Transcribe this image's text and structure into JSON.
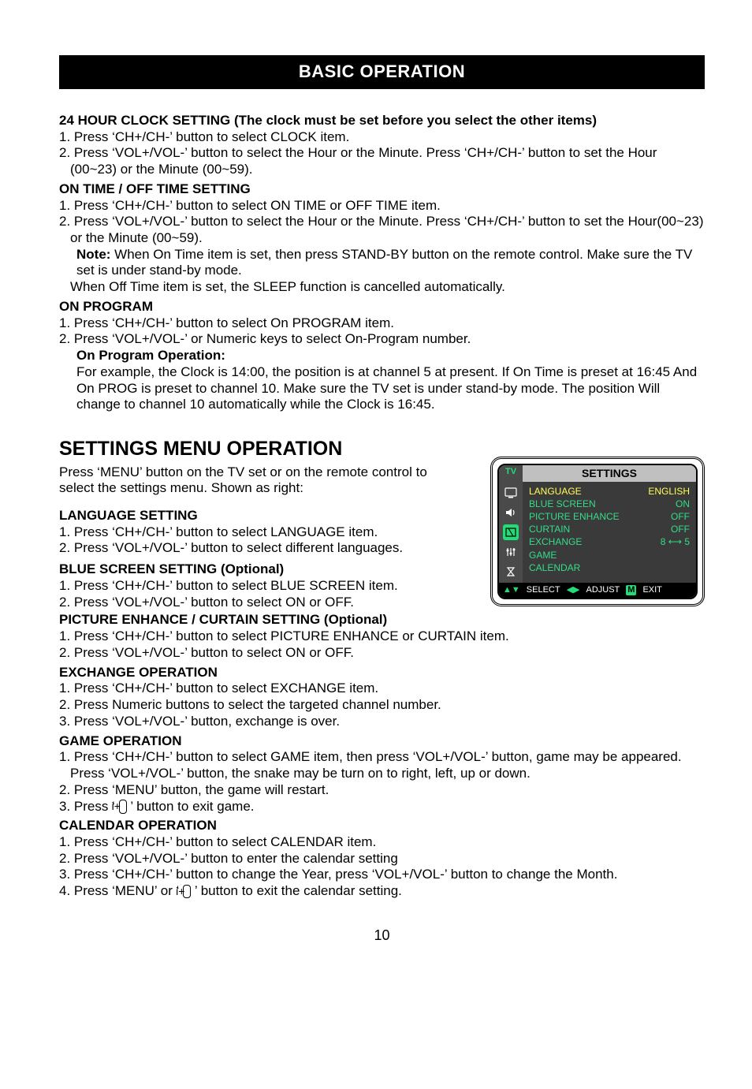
{
  "title_bar": "BASIC OPERATION",
  "clock": {
    "heading": "24 HOUR CLOCK SETTING (The clock must be set before you select the other items)",
    "p1": "1. Press ‘CH+/CH-’ button to select CLOCK item.",
    "p2": "2. Press ‘VOL+/VOL-’ button to select the Hour or the Minute. Press ‘CH+/CH-’ button to set the Hour (00~23) or the Minute (00~59)."
  },
  "ontime": {
    "heading": "ON TIME / OFF TIME SETTING",
    "p1": "1. Press ‘CH+/CH-’ button to select ON TIME or OFF TIME item.",
    "p2": "2. Press ‘VOL+/VOL-’ button to select the Hour or the Minute. Press ‘CH+/CH-’ button to set the Hour(00~23) or the Minute (00~59).",
    "note_label": "Note:",
    "note_body": " When On Time item is set, then press STAND-BY button on the remote control. Make sure the TV set is under stand-by mode.",
    "note2": "When Off Time item is set, the SLEEP function is cancelled automatically."
  },
  "onprog": {
    "heading": "ON PROGRAM",
    "p1": "1. Press ‘CH+/CH-’ button to select On PROGRAM item.",
    "p2": "2. Press ‘VOL+/VOL-’ or Numeric keys to select On-Program number.",
    "sub_heading": "On Program Operation:",
    "body": "For example, the Clock is 14:00, the position is at channel 5 at present. If On Time is preset at 16:45 And On PROG is preset to channel 10. Make sure the TV set is under stand-by mode. The position Will change to channel 10 automatically while the Clock is 16:45."
  },
  "settings": {
    "heading": "SETTINGS MENU OPERATION",
    "intro": "Press ‘MENU’ button on the TV set or on the remote control to select the settings menu. Shown as right:"
  },
  "lang": {
    "heading": "LANGUAGE SETTING",
    "p1": "1. Press ‘CH+/CH-’ button to select LANGUAGE item.",
    "p2": "2. Press ‘VOL+/VOL-’ button to select different languages."
  },
  "blue": {
    "heading": "BLUE SCREEN SETTING (Optional)",
    "p1": "1. Press ‘CH+/CH-’ button to select BLUE SCREEN item.",
    "p2": "2. Press ‘VOL+/VOL-’ button to select ON or OFF."
  },
  "pic": {
    "heading": "PICTURE ENHANCE / CURTAIN SETTING (Optional)",
    "p1": "1. Press ‘CH+/CH-’ button to select PICTURE ENHANCE or CURTAIN item.",
    "p2": "2. Press ‘VOL+/VOL-’ button to select ON or OFF."
  },
  "exch": {
    "heading": "EXCHANGE OPERATION",
    "p1": "1. Press ‘CH+/CH-’ button to select EXCHANGE item.",
    "p2": "2. Press Numeric buttons to select the targeted channel number.",
    "p3": "3. Press ‘VOL+/VOL-’ button, exchange is over."
  },
  "game": {
    "heading": "GAME OPERATION",
    "p1": "1. Press ‘CH+/CH-’ button to select GAME item, then press ‘VOL+/VOL-’ button, game may be appeared. Press ‘VOL+/VOL-’ button, the snake may be turn on to right, left, up or down.",
    "p2": "2. Press ‘MENU’ button, the game will restart.",
    "p3a": "3. Press ‘ ",
    "p3b": " ’ button to exit game."
  },
  "cal": {
    "heading": "CALENDAR OPERATION",
    "p1": "1. Press ‘CH+/CH-’ button to select CALENDAR item.",
    "p2": "2. Press ‘VOL+/VOL-’ button to enter the calendar setting",
    "p3": "3. Press ‘CH+/CH-’ button to change the Year, press ‘VOL+/VOL-’ button to change the Month.",
    "p4a": "4. Press ‘MENU’ or ‘ ",
    "p4b": " ’ button to exit the calendar setting."
  },
  "osd": {
    "tv": "TV",
    "title": "SETTINGS",
    "rows": [
      {
        "l": "LANGUAGE",
        "r": "ENGLISH",
        "hl": true
      },
      {
        "l": "BLUE SCREEN",
        "r": "ON"
      },
      {
        "l": "PICTURE ENHANCE",
        "r": "OFF"
      },
      {
        "l": "CURTAIN",
        "r": "OFF"
      },
      {
        "l": "EXCHANGE",
        "r": "8 ⟷ 5"
      },
      {
        "l": "GAME",
        "r": ""
      },
      {
        "l": "CALENDAR",
        "r": ""
      }
    ],
    "foot_select": "SELECT",
    "foot_adjust": "ADJUST",
    "foot_exit": "EXIT",
    "foot_m": "M"
  },
  "page_no": "10",
  "info_icon": "i+"
}
